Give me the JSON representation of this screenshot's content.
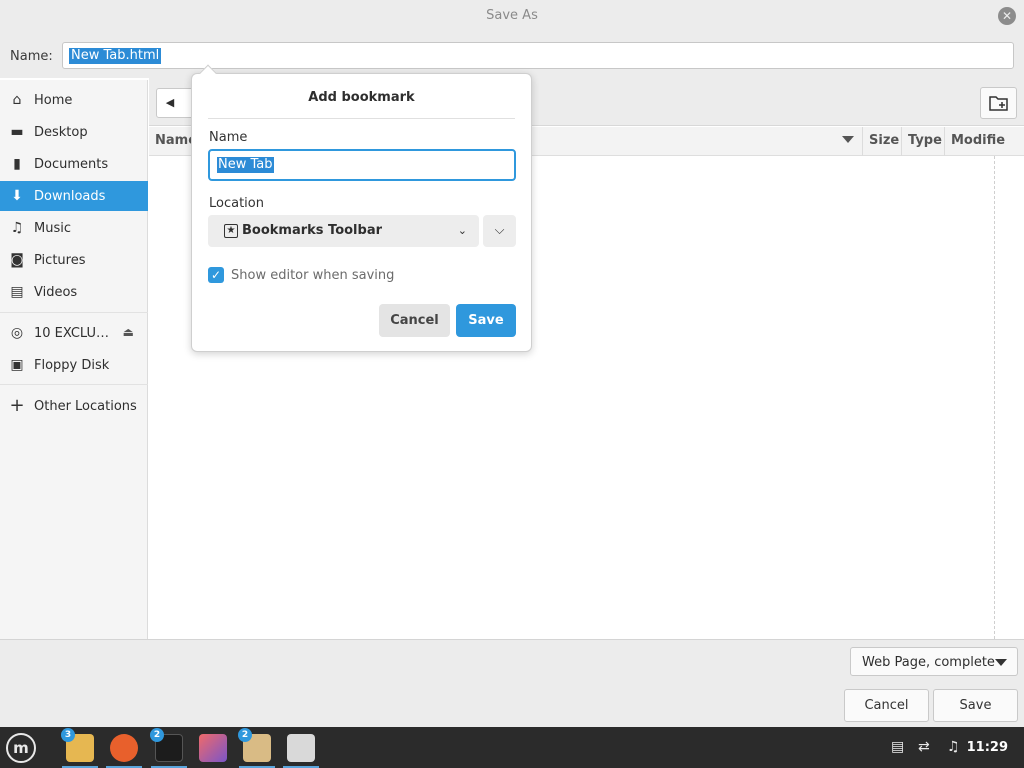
{
  "window": {
    "title": "Save As",
    "close_icon": "close-icon"
  },
  "name_row": {
    "label": "Name:",
    "value": "New Tab.html"
  },
  "sidebar": {
    "items": [
      {
        "label": "Home",
        "icon": "home-icon"
      },
      {
        "label": "Desktop",
        "icon": "desktop-icon"
      },
      {
        "label": "Documents",
        "icon": "documents-icon"
      },
      {
        "label": "Downloads",
        "icon": "downloads-icon",
        "active": true
      },
      {
        "label": "Music",
        "icon": "music-icon"
      },
      {
        "label": "Pictures",
        "icon": "pictures-icon"
      },
      {
        "label": "Videos",
        "icon": "videos-icon"
      },
      {
        "label": "10 EXCLU…",
        "icon": "disc-icon",
        "eject": true
      },
      {
        "label": "Floppy Disk",
        "icon": "floppy-icon"
      },
      {
        "label": "Other Locations",
        "icon": "plus-icon"
      }
    ]
  },
  "file_list": {
    "columns": [
      "Name",
      "Size",
      "Type",
      "Modifie"
    ]
  },
  "bookmark_popover": {
    "title": "Add bookmark",
    "name_label": "Name",
    "name_value": "New Tab",
    "location_label": "Location",
    "location_value": "Bookmarks Toolbar",
    "checkbox_label": "Show editor when saving",
    "checkbox_checked": true,
    "cancel_label": "Cancel",
    "save_label": "Save"
  },
  "footer": {
    "filter_value": "Web Page, complete",
    "cancel_label": "Cancel",
    "save_label": "Save"
  },
  "taskbar": {
    "apps": [
      {
        "name": "files",
        "badge": "3"
      },
      {
        "name": "firefox",
        "badge": ""
      },
      {
        "name": "terminal",
        "badge": "2"
      },
      {
        "name": "image-viewer",
        "badge": ""
      },
      {
        "name": "archive",
        "badge": "2"
      },
      {
        "name": "feedix",
        "badge": ""
      }
    ],
    "clock": "11:29"
  },
  "colors": {
    "accent": "#2f98dd",
    "titlebar": "#ececec",
    "taskbar": "#2b2b2b"
  }
}
